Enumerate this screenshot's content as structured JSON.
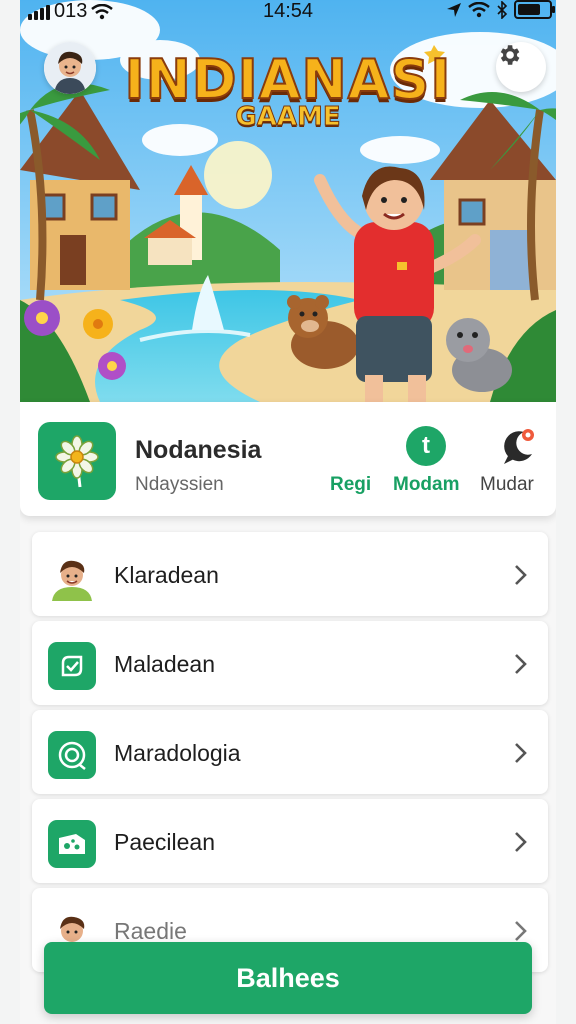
{
  "status_bar": {
    "carrier": "013",
    "time": "14:54"
  },
  "hero": {
    "title": "INDIANASI",
    "subtitle": "GAAME",
    "avatar_icon": "avatar-icon",
    "settings_icon": "gear-icon"
  },
  "app": {
    "name": "Nodanesia",
    "subtitle": "Ndayssien",
    "icon": "flower-icon",
    "actions": [
      {
        "label": "Regi",
        "icon": ""
      },
      {
        "label": "Modam",
        "icon": "plus-circle-icon",
        "glyph": "t"
      },
      {
        "label": "Mudar",
        "icon": "moon-chat-icon"
      }
    ]
  },
  "list": [
    {
      "label": "Klaradean",
      "icon": "avatar-icon"
    },
    {
      "label": "Maladean",
      "icon": "check-badge-icon"
    },
    {
      "label": "Maradologia",
      "icon": "target-icon"
    },
    {
      "label": "Paecilean",
      "icon": "cheese-icon"
    },
    {
      "label": "Raedie",
      "icon": "avatar-icon"
    }
  ],
  "bottom_button": {
    "label": "Balhees"
  },
  "colors": {
    "accent": "#1ea667",
    "title_gold": "#f6b21b"
  }
}
